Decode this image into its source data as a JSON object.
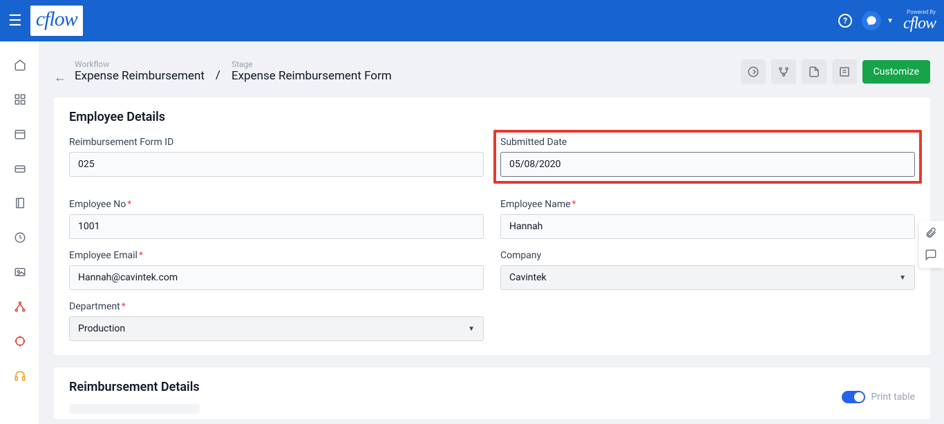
{
  "header": {
    "logo_text": "cflow",
    "powered_small": "Powered By",
    "powered_logo": "cflow"
  },
  "breadcrumb": {
    "workflow_label": "Workflow",
    "workflow_value": "Expense Reimbursement",
    "stage_label": "Stage",
    "stage_value": "Expense Reimbursement Form",
    "separator": "/"
  },
  "actions": {
    "customize": "Customize"
  },
  "section1": {
    "title": "Employee Details",
    "fields": {
      "form_id": {
        "label": "Reimbursement Form ID",
        "value": "025"
      },
      "submitted_date": {
        "label": "Submitted Date",
        "value": "05/08/2020"
      },
      "employee_no": {
        "label": "Employee No",
        "value": "1001",
        "required": true
      },
      "employee_name": {
        "label": "Employee Name",
        "value": "Hannah",
        "required": true
      },
      "employee_email": {
        "label": "Employee Email",
        "value": "Hannah@cavintek.com",
        "required": true
      },
      "company": {
        "label": "Company",
        "value": "Cavintek"
      },
      "department": {
        "label": "Department",
        "value": "Production",
        "required": true
      }
    }
  },
  "section2": {
    "title": "Reimbursement Details",
    "print_table": "Print table"
  }
}
